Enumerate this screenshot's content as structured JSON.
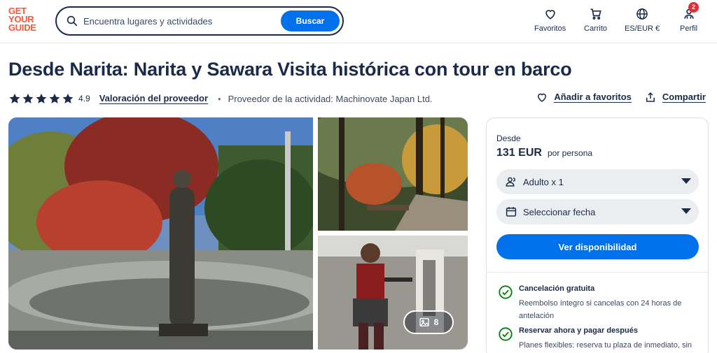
{
  "header": {
    "logo": [
      "GET",
      "YOUR",
      "GUIDE"
    ],
    "search_placeholder": "Encuentra lugares y actividades",
    "search_button": "Buscar",
    "nav": [
      {
        "label": "Favoritos",
        "icon": "heart-icon"
      },
      {
        "label": "Carrito",
        "icon": "cart-icon"
      },
      {
        "label": "ES/EUR €",
        "icon": "globe-icon"
      },
      {
        "label": "Perfil",
        "icon": "profile-icon",
        "badge": "2"
      }
    ]
  },
  "activity": {
    "title": "Desde Narita: Narita y Sawara Visita histórica con tour en barco",
    "rating": "4.9",
    "stars": 5,
    "provider_rating_link": "Valoración del proveedor",
    "provider_text": "Proveedor de la actividad: Machinovate Japan Ltd.",
    "add_favorites": "Añadir a favoritos",
    "share": "Compartir"
  },
  "gallery": {
    "more_photos_count": "8"
  },
  "booking": {
    "from_label": "Desde",
    "price": "131 EUR",
    "per_person": "por persona",
    "participants": "Adulto x 1",
    "date_placeholder": "Seleccionar fecha",
    "cta": "Ver disponibilidad",
    "features": [
      {
        "title": "Cancelación gratuita",
        "desc": "Reembolso íntegro si cancelas con 24 horas de antelación"
      },
      {
        "title": "Reservar ahora y pagar después",
        "desc": "Planes flexibles: reserva tu plaza de inmediato, sin"
      }
    ]
  },
  "colors": {
    "brand": "#ff5533",
    "accent": "#0071eb",
    "text": "#1a2b49",
    "success": "#008009",
    "badge": "#eb2a38"
  }
}
